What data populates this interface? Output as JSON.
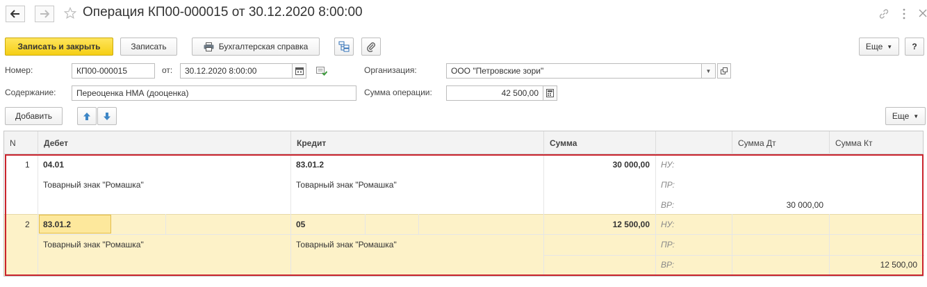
{
  "header": {
    "title": "Операция КП00-000015 от 30.12.2020 8:00:00"
  },
  "toolbar": {
    "save_close_label": "Записать и закрыть",
    "save_label": "Записать",
    "report_label": "Бухгалтерская справка",
    "more_label": "Еще",
    "help_label": "?"
  },
  "form": {
    "number_label": "Номер:",
    "number_value": "КП00-000015",
    "date_label": "от:",
    "date_value": "30.12.2020  8:00:00",
    "org_label": "Организация:",
    "org_value": "ООО \"Петровские зори\"",
    "content_label": "Содержание:",
    "content_value": "Переоценка НМА  (дооценка)",
    "sum_label": "Сумма операции:",
    "sum_value": "42 500,00"
  },
  "table_toolbar": {
    "add_label": "Добавить",
    "more_label": "Еще"
  },
  "table": {
    "columns": [
      "N",
      "Дебет",
      "Кредит",
      "Сумма",
      "",
      "Сумма Дт",
      "Сумма Кт"
    ],
    "rows": [
      {
        "n": "1",
        "debit": "04.01",
        "debit_sub": "Товарный знак \"Ромашка\"",
        "credit": "83.01.2",
        "credit_sub": "Товарный знак \"Ромашка\"",
        "sum": "30 000,00",
        "nu": "НУ:",
        "pr": "ПР:",
        "vr": "ВР:",
        "vr_dt": "30 000,00",
        "vr_kt": ""
      },
      {
        "n": "2",
        "debit": "83.01.2",
        "debit_sub": "Товарный знак \"Ромашка\"",
        "credit": "05",
        "credit_sub": "Товарный знак \"Ромашка\"",
        "sum": "12 500,00",
        "nu": "НУ:",
        "pr": "ПР:",
        "vr": "ВР:",
        "vr_dt": "",
        "vr_kt": "12 500,00"
      }
    ]
  },
  "colors": {
    "primary_button": "#f5cf14",
    "selected_row": "#fdf2c8",
    "highlight_outline": "#c9232c"
  },
  "icons": [
    "back-arrow-icon",
    "forward-arrow-icon",
    "star-icon",
    "link-icon",
    "more-vertical-icon",
    "close-icon",
    "printer-icon",
    "structure-icon",
    "paperclip-icon",
    "calendar-icon",
    "post-document-icon",
    "open-icon",
    "arrow-up-icon",
    "arrow-down-icon"
  ]
}
